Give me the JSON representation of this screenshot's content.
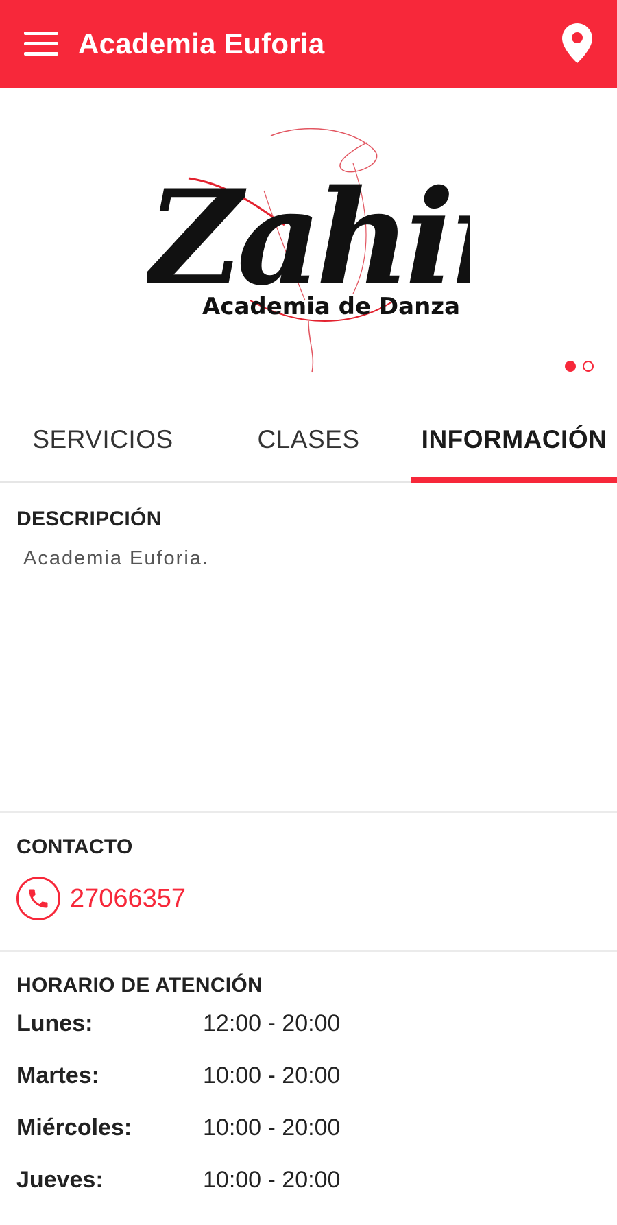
{
  "appbar": {
    "title": "Academia Euforia",
    "menu_icon": "hamburger-menu-icon",
    "location_icon": "location-pin-icon",
    "color": "#f7283a"
  },
  "banner": {
    "logo_text": "Zahir",
    "logo_subtitle": "Academia de Danza",
    "slides": 2,
    "active_slide": 1
  },
  "tabs": [
    {
      "label": "SERVICIOS",
      "selected": false
    },
    {
      "label": "CLASES",
      "selected": false
    },
    {
      "label": "INFORMACIÓN",
      "selected": true
    }
  ],
  "description": {
    "title": "DESCRIPCIÓN",
    "text": "Academia Euforia."
  },
  "contact": {
    "title": "CONTACTO",
    "phone_icon": "phone-icon",
    "phone": "27066357"
  },
  "hours": {
    "title": "HORARIO DE ATENCIÓN",
    "rows": [
      {
        "day": "Lunes:",
        "time": "12:00 - 20:00"
      },
      {
        "day": "Martes:",
        "time": "10:00 - 20:00"
      },
      {
        "day": "Miércoles:",
        "time": "10:00 - 20:00"
      },
      {
        "day": "Jueves:",
        "time": "10:00 - 20:00"
      }
    ]
  }
}
